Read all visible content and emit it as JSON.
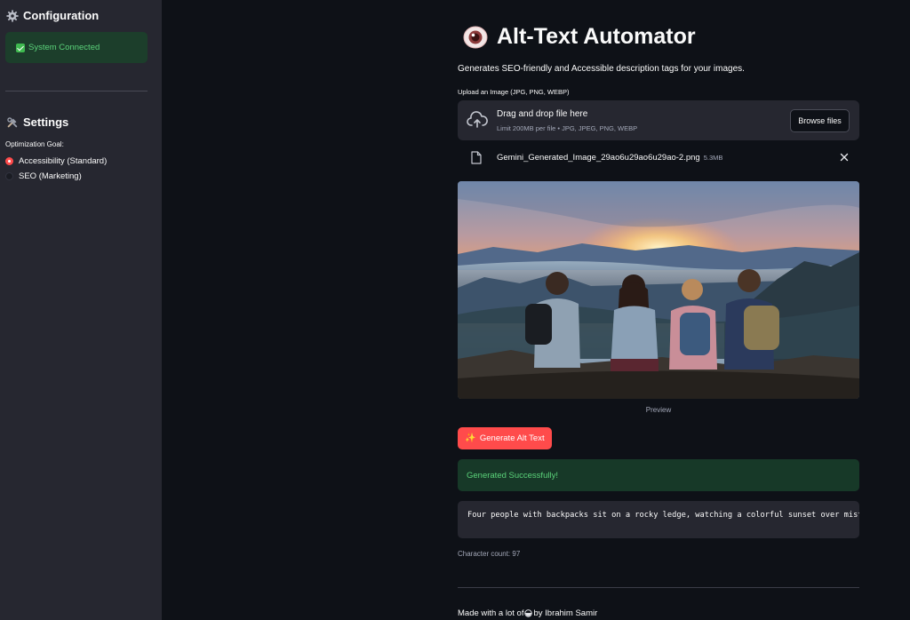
{
  "sidebar": {
    "config_title": "Configuration",
    "status_text": "System Connected",
    "settings_title": "Settings",
    "optimization_label": "Optimization Goal:",
    "options": [
      {
        "label": "Accessibility (Standard)",
        "selected": true
      },
      {
        "label": "SEO (Marketing)",
        "selected": false
      }
    ]
  },
  "main": {
    "title": "Alt-Text Automator",
    "subtitle": "Generates SEO-friendly and Accessible description tags for your images.",
    "upload_label": "Upload an Image (JPG, PNG, WEBP)",
    "dropzone": {
      "title": "Drag and drop file here",
      "limit": "Limit 200MB per file • JPG, JPEG, PNG, WEBP",
      "browse_label": "Browse files"
    },
    "file": {
      "name": "Gemini_Generated_Image_29ao6u29ao6u29ao-2.png",
      "size": "5.3MB"
    },
    "preview_caption": "Preview",
    "generate_label": "Generate Alt Text",
    "success_text": "Generated Successfully!",
    "alt_text": "Four people with backpacks sit on a rocky ledge, watching a colorful sunset over misty mountains.",
    "char_count": "Character count: 97",
    "footer_prefix": "Made with a lot of",
    "footer_suffix": "by Ibrahim Samir"
  },
  "colors": {
    "background": "#0e1117",
    "sidebar": "#262730",
    "accent": "#ff4b4b",
    "success_bg": "#173928",
    "success_text": "#5bd37a"
  }
}
